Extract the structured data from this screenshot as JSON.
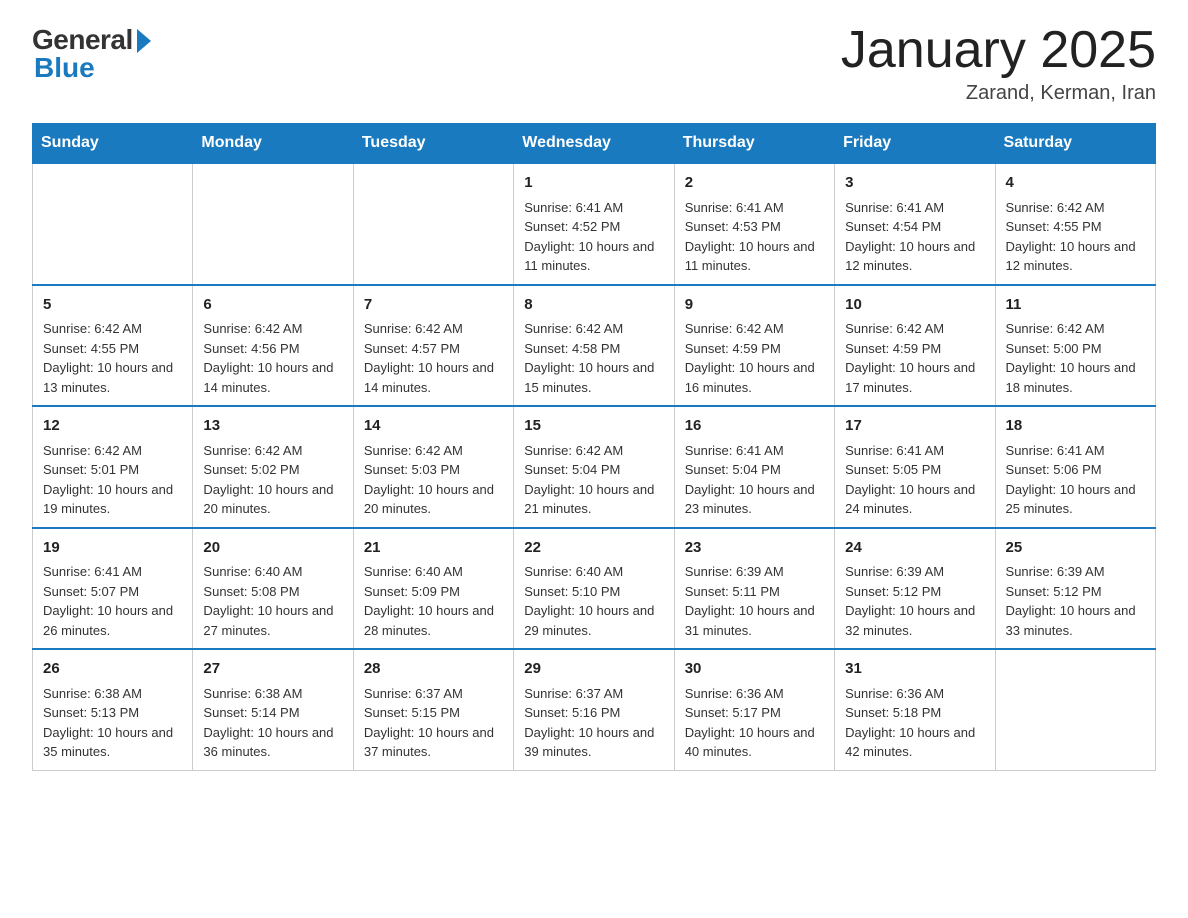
{
  "header": {
    "logo_general": "General",
    "logo_blue": "Blue",
    "month_title": "January 2025",
    "location": "Zarand, Kerman, Iran"
  },
  "days_of_week": [
    "Sunday",
    "Monday",
    "Tuesday",
    "Wednesday",
    "Thursday",
    "Friday",
    "Saturday"
  ],
  "weeks": [
    [
      {
        "day": "",
        "sunrise": "",
        "sunset": "",
        "daylight": ""
      },
      {
        "day": "",
        "sunrise": "",
        "sunset": "",
        "daylight": ""
      },
      {
        "day": "",
        "sunrise": "",
        "sunset": "",
        "daylight": ""
      },
      {
        "day": "1",
        "sunrise": "Sunrise: 6:41 AM",
        "sunset": "Sunset: 4:52 PM",
        "daylight": "Daylight: 10 hours and 11 minutes."
      },
      {
        "day": "2",
        "sunrise": "Sunrise: 6:41 AM",
        "sunset": "Sunset: 4:53 PM",
        "daylight": "Daylight: 10 hours and 11 minutes."
      },
      {
        "day": "3",
        "sunrise": "Sunrise: 6:41 AM",
        "sunset": "Sunset: 4:54 PM",
        "daylight": "Daylight: 10 hours and 12 minutes."
      },
      {
        "day": "4",
        "sunrise": "Sunrise: 6:42 AM",
        "sunset": "Sunset: 4:55 PM",
        "daylight": "Daylight: 10 hours and 12 minutes."
      }
    ],
    [
      {
        "day": "5",
        "sunrise": "Sunrise: 6:42 AM",
        "sunset": "Sunset: 4:55 PM",
        "daylight": "Daylight: 10 hours and 13 minutes."
      },
      {
        "day": "6",
        "sunrise": "Sunrise: 6:42 AM",
        "sunset": "Sunset: 4:56 PM",
        "daylight": "Daylight: 10 hours and 14 minutes."
      },
      {
        "day": "7",
        "sunrise": "Sunrise: 6:42 AM",
        "sunset": "Sunset: 4:57 PM",
        "daylight": "Daylight: 10 hours and 14 minutes."
      },
      {
        "day": "8",
        "sunrise": "Sunrise: 6:42 AM",
        "sunset": "Sunset: 4:58 PM",
        "daylight": "Daylight: 10 hours and 15 minutes."
      },
      {
        "day": "9",
        "sunrise": "Sunrise: 6:42 AM",
        "sunset": "Sunset: 4:59 PM",
        "daylight": "Daylight: 10 hours and 16 minutes."
      },
      {
        "day": "10",
        "sunrise": "Sunrise: 6:42 AM",
        "sunset": "Sunset: 4:59 PM",
        "daylight": "Daylight: 10 hours and 17 minutes."
      },
      {
        "day": "11",
        "sunrise": "Sunrise: 6:42 AM",
        "sunset": "Sunset: 5:00 PM",
        "daylight": "Daylight: 10 hours and 18 minutes."
      }
    ],
    [
      {
        "day": "12",
        "sunrise": "Sunrise: 6:42 AM",
        "sunset": "Sunset: 5:01 PM",
        "daylight": "Daylight: 10 hours and 19 minutes."
      },
      {
        "day": "13",
        "sunrise": "Sunrise: 6:42 AM",
        "sunset": "Sunset: 5:02 PM",
        "daylight": "Daylight: 10 hours and 20 minutes."
      },
      {
        "day": "14",
        "sunrise": "Sunrise: 6:42 AM",
        "sunset": "Sunset: 5:03 PM",
        "daylight": "Daylight: 10 hours and 20 minutes."
      },
      {
        "day": "15",
        "sunrise": "Sunrise: 6:42 AM",
        "sunset": "Sunset: 5:04 PM",
        "daylight": "Daylight: 10 hours and 21 minutes."
      },
      {
        "day": "16",
        "sunrise": "Sunrise: 6:41 AM",
        "sunset": "Sunset: 5:04 PM",
        "daylight": "Daylight: 10 hours and 23 minutes."
      },
      {
        "day": "17",
        "sunrise": "Sunrise: 6:41 AM",
        "sunset": "Sunset: 5:05 PM",
        "daylight": "Daylight: 10 hours and 24 minutes."
      },
      {
        "day": "18",
        "sunrise": "Sunrise: 6:41 AM",
        "sunset": "Sunset: 5:06 PM",
        "daylight": "Daylight: 10 hours and 25 minutes."
      }
    ],
    [
      {
        "day": "19",
        "sunrise": "Sunrise: 6:41 AM",
        "sunset": "Sunset: 5:07 PM",
        "daylight": "Daylight: 10 hours and 26 minutes."
      },
      {
        "day": "20",
        "sunrise": "Sunrise: 6:40 AM",
        "sunset": "Sunset: 5:08 PM",
        "daylight": "Daylight: 10 hours and 27 minutes."
      },
      {
        "day": "21",
        "sunrise": "Sunrise: 6:40 AM",
        "sunset": "Sunset: 5:09 PM",
        "daylight": "Daylight: 10 hours and 28 minutes."
      },
      {
        "day": "22",
        "sunrise": "Sunrise: 6:40 AM",
        "sunset": "Sunset: 5:10 PM",
        "daylight": "Daylight: 10 hours and 29 minutes."
      },
      {
        "day": "23",
        "sunrise": "Sunrise: 6:39 AM",
        "sunset": "Sunset: 5:11 PM",
        "daylight": "Daylight: 10 hours and 31 minutes."
      },
      {
        "day": "24",
        "sunrise": "Sunrise: 6:39 AM",
        "sunset": "Sunset: 5:12 PM",
        "daylight": "Daylight: 10 hours and 32 minutes."
      },
      {
        "day": "25",
        "sunrise": "Sunrise: 6:39 AM",
        "sunset": "Sunset: 5:12 PM",
        "daylight": "Daylight: 10 hours and 33 minutes."
      }
    ],
    [
      {
        "day": "26",
        "sunrise": "Sunrise: 6:38 AM",
        "sunset": "Sunset: 5:13 PM",
        "daylight": "Daylight: 10 hours and 35 minutes."
      },
      {
        "day": "27",
        "sunrise": "Sunrise: 6:38 AM",
        "sunset": "Sunset: 5:14 PM",
        "daylight": "Daylight: 10 hours and 36 minutes."
      },
      {
        "day": "28",
        "sunrise": "Sunrise: 6:37 AM",
        "sunset": "Sunset: 5:15 PM",
        "daylight": "Daylight: 10 hours and 37 minutes."
      },
      {
        "day": "29",
        "sunrise": "Sunrise: 6:37 AM",
        "sunset": "Sunset: 5:16 PM",
        "daylight": "Daylight: 10 hours and 39 minutes."
      },
      {
        "day": "30",
        "sunrise": "Sunrise: 6:36 AM",
        "sunset": "Sunset: 5:17 PM",
        "daylight": "Daylight: 10 hours and 40 minutes."
      },
      {
        "day": "31",
        "sunrise": "Sunrise: 6:36 AM",
        "sunset": "Sunset: 5:18 PM",
        "daylight": "Daylight: 10 hours and 42 minutes."
      },
      {
        "day": "",
        "sunrise": "",
        "sunset": "",
        "daylight": ""
      }
    ]
  ]
}
